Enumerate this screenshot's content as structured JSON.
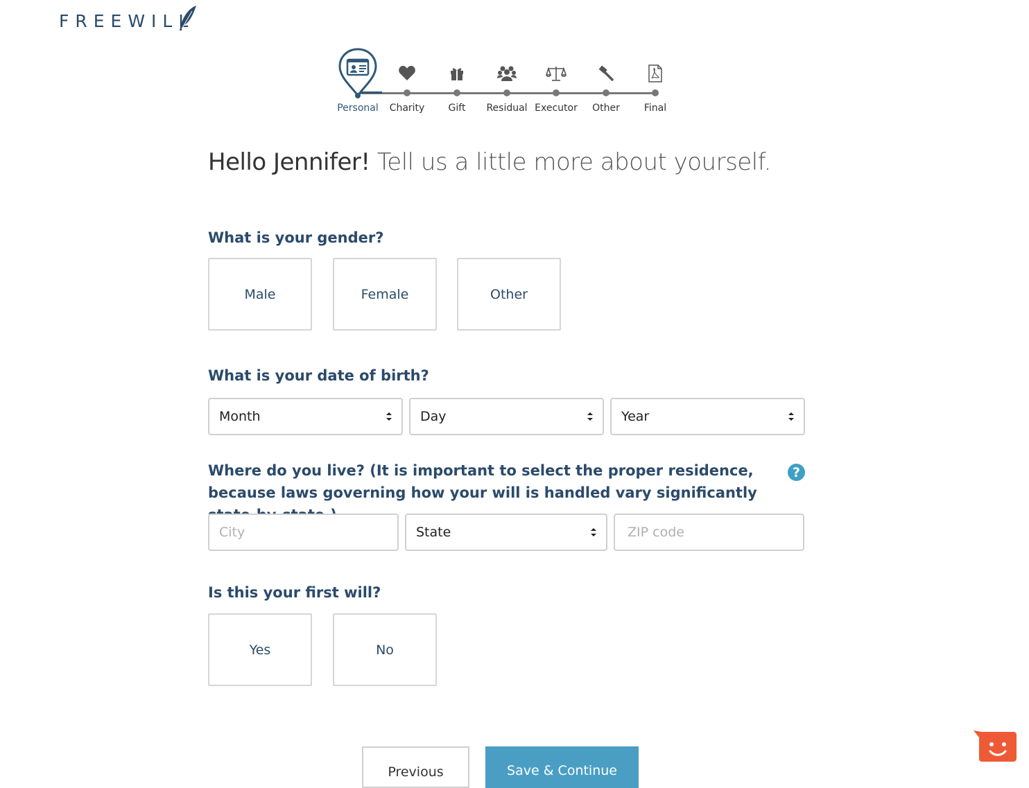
{
  "brand": {
    "name": "FREEWILL"
  },
  "stepper": {
    "steps": [
      {
        "label": "Personal",
        "icon": "id-card-icon",
        "active": true
      },
      {
        "label": "Charity",
        "icon": "heart-icon"
      },
      {
        "label": "Gift",
        "icon": "gift-icon"
      },
      {
        "label": "Residual",
        "icon": "people-icon"
      },
      {
        "label": "Executor",
        "icon": "scales-icon"
      },
      {
        "label": "Other",
        "icon": "gavel-icon"
      },
      {
        "label": "Final",
        "icon": "pdf-icon"
      }
    ]
  },
  "greeting": {
    "name": "Hello Jennifer!",
    "rest": " Tell us a little more about yourself."
  },
  "gender": {
    "question": "What is your gender?",
    "options": [
      "Male",
      "Female",
      "Other"
    ]
  },
  "dob": {
    "question": "What is your date of birth?",
    "month": "Month",
    "day": "Day",
    "year": "Year"
  },
  "residence": {
    "question": "Where do you live? (It is important to select the proper residence, because laws governing how your will is handled vary significantly state-by-state.)",
    "help": "?",
    "city_placeholder": "City",
    "state": "State",
    "zip_placeholder": "ZIP code"
  },
  "first_will": {
    "question": "Is this your first will?",
    "options": [
      "Yes",
      "No"
    ]
  },
  "actions": {
    "previous": "Previous",
    "save": "Save & Continue"
  },
  "colors": {
    "brand": "#2b4a6b",
    "accent": "#4a9ec4",
    "chat": "#ee5a35"
  }
}
